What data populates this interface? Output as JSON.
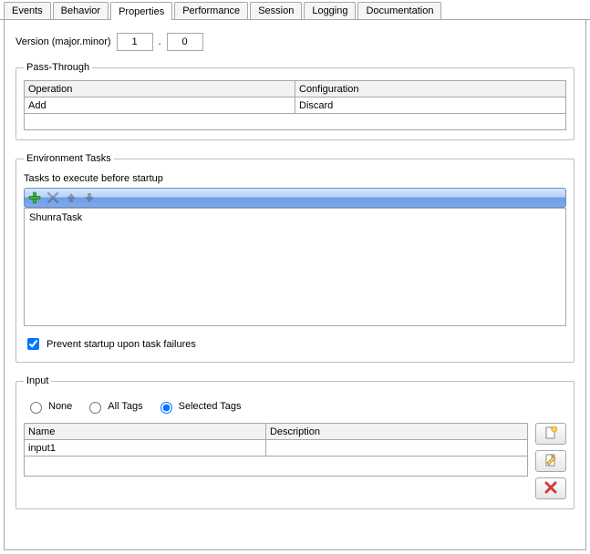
{
  "tabs": {
    "events": "Events",
    "behavior": "Behavior",
    "properties": "Properties",
    "performance": "Performance",
    "session": "Session",
    "logging": "Logging",
    "documentation": "Documentation",
    "active": "properties"
  },
  "version": {
    "label": "Version (major.minor)",
    "major": "1",
    "dot": ".",
    "minor": "0"
  },
  "passthrough": {
    "legend": "Pass-Through",
    "headers": {
      "operation": "Operation",
      "configuration": "Configuration"
    },
    "rows": [
      {
        "operation": "Add",
        "configuration": "Discard"
      }
    ]
  },
  "env": {
    "legend": "Environment Tasks",
    "subtitle": "Tasks to execute before startup",
    "toolbar": {
      "add": "plus-icon",
      "remove": "x-icon",
      "up": "arrow-up-icon",
      "down": "arrow-down-icon"
    },
    "tasks": [
      "ShunraTask"
    ],
    "preventLabel": "Prevent startup upon task failures",
    "preventChecked": true
  },
  "input": {
    "legend": "Input",
    "radios": {
      "none": "None",
      "all": "All Tags",
      "selected": "Selected Tags",
      "value": "selected"
    },
    "headers": {
      "name": "Name",
      "description": "Description"
    },
    "rows": [
      {
        "name": "input1",
        "description": ""
      }
    ],
    "buttons": {
      "new": "new-doc-icon",
      "edit": "edit-doc-icon",
      "delete": "delete-icon"
    }
  }
}
